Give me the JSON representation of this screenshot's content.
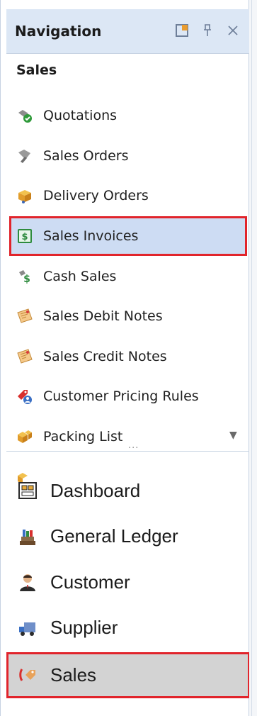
{
  "header": {
    "title": "Navigation"
  },
  "section": {
    "title": "Sales"
  },
  "menu": [
    {
      "label": "Quotations",
      "icon": "quotations-icon"
    },
    {
      "label": "Sales Orders",
      "icon": "sales-orders-icon"
    },
    {
      "label": "Delivery Orders",
      "icon": "delivery-orders-icon"
    },
    {
      "label": "Sales Invoices",
      "icon": "sales-invoices-icon",
      "selected": true
    },
    {
      "label": "Cash Sales",
      "icon": "cash-sales-icon"
    },
    {
      "label": "Sales Debit Notes",
      "icon": "debit-notes-icon"
    },
    {
      "label": "Sales Credit Notes",
      "icon": "credit-notes-icon"
    },
    {
      "label": "Customer Pricing Rules",
      "icon": "pricing-rules-icon"
    },
    {
      "label": "Packing List",
      "icon": "packing-list-icon"
    }
  ],
  "nav": [
    {
      "label": "Dashboard",
      "icon": "dashboard-icon"
    },
    {
      "label": "General Ledger",
      "icon": "general-ledger-icon"
    },
    {
      "label": "Customer",
      "icon": "customer-icon"
    },
    {
      "label": "Supplier",
      "icon": "supplier-icon"
    },
    {
      "label": "Sales",
      "icon": "sales-icon",
      "active": true
    }
  ],
  "colors": {
    "highlight": "#e1242b",
    "selection": "#cddcf3",
    "header_bg": "#dce7f5"
  }
}
